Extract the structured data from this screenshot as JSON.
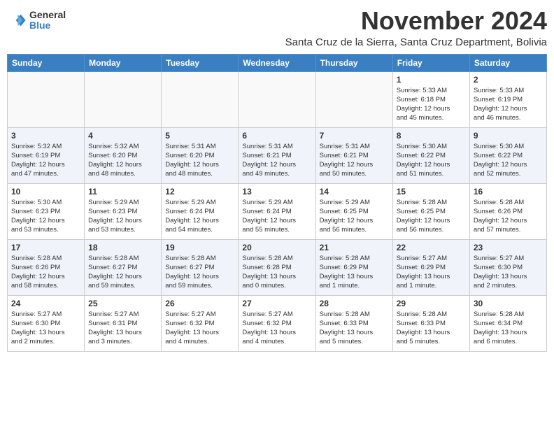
{
  "header": {
    "logo_general": "General",
    "logo_blue": "Blue",
    "month_title": "November 2024",
    "subtitle": "Santa Cruz de la Sierra, Santa Cruz Department, Bolivia"
  },
  "days_of_week": [
    "Sunday",
    "Monday",
    "Tuesday",
    "Wednesday",
    "Thursday",
    "Friday",
    "Saturday"
  ],
  "weeks": [
    [
      {
        "day": "",
        "info": ""
      },
      {
        "day": "",
        "info": ""
      },
      {
        "day": "",
        "info": ""
      },
      {
        "day": "",
        "info": ""
      },
      {
        "day": "",
        "info": ""
      },
      {
        "day": "1",
        "info": "Sunrise: 5:33 AM\nSunset: 6:18 PM\nDaylight: 12 hours\nand 45 minutes."
      },
      {
        "day": "2",
        "info": "Sunrise: 5:33 AM\nSunset: 6:19 PM\nDaylight: 12 hours\nand 46 minutes."
      }
    ],
    [
      {
        "day": "3",
        "info": "Sunrise: 5:32 AM\nSunset: 6:19 PM\nDaylight: 12 hours\nand 47 minutes."
      },
      {
        "day": "4",
        "info": "Sunrise: 5:32 AM\nSunset: 6:20 PM\nDaylight: 12 hours\nand 48 minutes."
      },
      {
        "day": "5",
        "info": "Sunrise: 5:31 AM\nSunset: 6:20 PM\nDaylight: 12 hours\nand 48 minutes."
      },
      {
        "day": "6",
        "info": "Sunrise: 5:31 AM\nSunset: 6:21 PM\nDaylight: 12 hours\nand 49 minutes."
      },
      {
        "day": "7",
        "info": "Sunrise: 5:31 AM\nSunset: 6:21 PM\nDaylight: 12 hours\nand 50 minutes."
      },
      {
        "day": "8",
        "info": "Sunrise: 5:30 AM\nSunset: 6:22 PM\nDaylight: 12 hours\nand 51 minutes."
      },
      {
        "day": "9",
        "info": "Sunrise: 5:30 AM\nSunset: 6:22 PM\nDaylight: 12 hours\nand 52 minutes."
      }
    ],
    [
      {
        "day": "10",
        "info": "Sunrise: 5:30 AM\nSunset: 6:23 PM\nDaylight: 12 hours\nand 53 minutes."
      },
      {
        "day": "11",
        "info": "Sunrise: 5:29 AM\nSunset: 6:23 PM\nDaylight: 12 hours\nand 53 minutes."
      },
      {
        "day": "12",
        "info": "Sunrise: 5:29 AM\nSunset: 6:24 PM\nDaylight: 12 hours\nand 54 minutes."
      },
      {
        "day": "13",
        "info": "Sunrise: 5:29 AM\nSunset: 6:24 PM\nDaylight: 12 hours\nand 55 minutes."
      },
      {
        "day": "14",
        "info": "Sunrise: 5:29 AM\nSunset: 6:25 PM\nDaylight: 12 hours\nand 56 minutes."
      },
      {
        "day": "15",
        "info": "Sunrise: 5:28 AM\nSunset: 6:25 PM\nDaylight: 12 hours\nand 56 minutes."
      },
      {
        "day": "16",
        "info": "Sunrise: 5:28 AM\nSunset: 6:26 PM\nDaylight: 12 hours\nand 57 minutes."
      }
    ],
    [
      {
        "day": "17",
        "info": "Sunrise: 5:28 AM\nSunset: 6:26 PM\nDaylight: 12 hours\nand 58 minutes."
      },
      {
        "day": "18",
        "info": "Sunrise: 5:28 AM\nSunset: 6:27 PM\nDaylight: 12 hours\nand 59 minutes."
      },
      {
        "day": "19",
        "info": "Sunrise: 5:28 AM\nSunset: 6:27 PM\nDaylight: 12 hours\nand 59 minutes."
      },
      {
        "day": "20",
        "info": "Sunrise: 5:28 AM\nSunset: 6:28 PM\nDaylight: 13 hours\nand 0 minutes."
      },
      {
        "day": "21",
        "info": "Sunrise: 5:28 AM\nSunset: 6:29 PM\nDaylight: 13 hours\nand 1 minute."
      },
      {
        "day": "22",
        "info": "Sunrise: 5:27 AM\nSunset: 6:29 PM\nDaylight: 13 hours\nand 1 minute."
      },
      {
        "day": "23",
        "info": "Sunrise: 5:27 AM\nSunset: 6:30 PM\nDaylight: 13 hours\nand 2 minutes."
      }
    ],
    [
      {
        "day": "24",
        "info": "Sunrise: 5:27 AM\nSunset: 6:30 PM\nDaylight: 13 hours\nand 2 minutes."
      },
      {
        "day": "25",
        "info": "Sunrise: 5:27 AM\nSunset: 6:31 PM\nDaylight: 13 hours\nand 3 minutes."
      },
      {
        "day": "26",
        "info": "Sunrise: 5:27 AM\nSunset: 6:32 PM\nDaylight: 13 hours\nand 4 minutes."
      },
      {
        "day": "27",
        "info": "Sunrise: 5:27 AM\nSunset: 6:32 PM\nDaylight: 13 hours\nand 4 minutes."
      },
      {
        "day": "28",
        "info": "Sunrise: 5:28 AM\nSunset: 6:33 PM\nDaylight: 13 hours\nand 5 minutes."
      },
      {
        "day": "29",
        "info": "Sunrise: 5:28 AM\nSunset: 6:33 PM\nDaylight: 13 hours\nand 5 minutes."
      },
      {
        "day": "30",
        "info": "Sunrise: 5:28 AM\nSunset: 6:34 PM\nDaylight: 13 hours\nand 6 minutes."
      }
    ]
  ]
}
